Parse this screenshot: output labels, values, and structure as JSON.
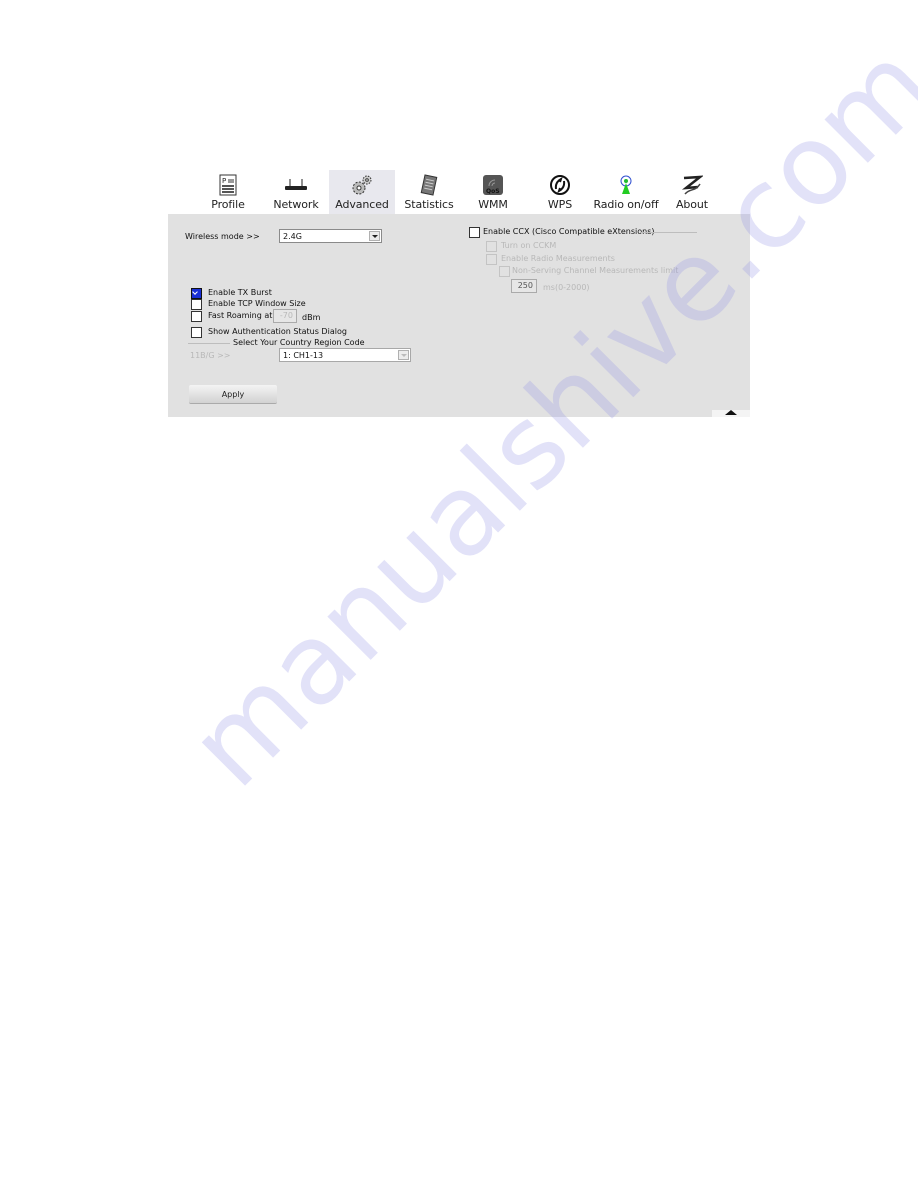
{
  "tabs": [
    {
      "id": "profile",
      "label": "Profile",
      "icon": "profile-icon",
      "active": false
    },
    {
      "id": "network",
      "label": "Network",
      "icon": "router-icon",
      "active": false
    },
    {
      "id": "advanced",
      "label": "Advanced",
      "icon": "gears-icon",
      "active": true
    },
    {
      "id": "statistics",
      "label": "Statistics",
      "icon": "statistics-icon",
      "active": false
    },
    {
      "id": "wmm",
      "label": "WMM",
      "icon": "qos-icon",
      "active": false
    },
    {
      "id": "wps",
      "label": "WPS",
      "icon": "wps-icon",
      "active": false
    },
    {
      "id": "radio",
      "label": "Radio on/off",
      "icon": "radio-antenna-icon",
      "active": false
    },
    {
      "id": "about",
      "label": "About",
      "icon": "about-logo-icon",
      "active": false
    }
  ],
  "advanced": {
    "wireless_mode": {
      "label": "Wireless mode >>",
      "value": "2.4G"
    },
    "options": {
      "tx_burst": {
        "label": "Enable TX Burst",
        "checked": true
      },
      "tcp_window": {
        "label": "Enable TCP Window Size",
        "checked": false
      },
      "fast_roaming": {
        "label": "Fast Roaming at",
        "checked": false,
        "value": "-70",
        "unit": "dBm"
      },
      "auth_dialog": {
        "label": "Show Authentication Status Dialog",
        "checked": false
      }
    },
    "country_region": {
      "heading": "Select Your Country Region Code",
      "band_label": "11B/G >>",
      "value": "1: CH1-13"
    },
    "ccx": {
      "label": "Enable CCX (Cisco Compatible eXtensions)",
      "checked": false,
      "cckm": {
        "label": "Turn on CCKM",
        "checked": false
      },
      "radio_measurements": {
        "label": "Enable Radio Measurements",
        "checked": false
      },
      "non_serving": {
        "label": "Non-Serving Channel Measurements limit",
        "checked": false
      },
      "limit_value": "250",
      "limit_unit": "ms(0-2000)"
    },
    "apply_label": "Apply"
  },
  "watermark": "manualshive.com",
  "colors": {
    "panel": "#e1e1e1",
    "active_tab": "#e8e8ee",
    "checked": "#1a2fd6"
  }
}
